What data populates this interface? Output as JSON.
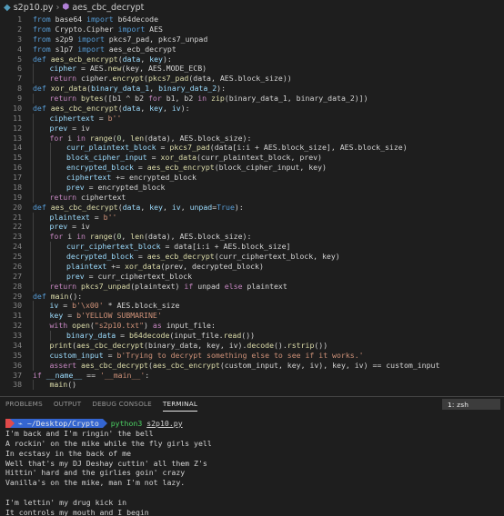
{
  "breadcrumb": {
    "file": "s2p10.py",
    "symbol": "aes_cbc_decrypt"
  },
  "editor": {
    "lines": [
      {
        "n": "1",
        "tokens": [
          [
            "kw",
            "from"
          ],
          [
            "op",
            " base64 "
          ],
          [
            "kw",
            "import"
          ],
          [
            "op",
            " b64decode"
          ]
        ]
      },
      {
        "n": "2",
        "tokens": [
          [
            "kw",
            "from"
          ],
          [
            "op",
            " Crypto.Cipher "
          ],
          [
            "kw",
            "import"
          ],
          [
            "op",
            " AES"
          ]
        ]
      },
      {
        "n": "3",
        "tokens": [
          [
            "kw",
            "from"
          ],
          [
            "op",
            " s2p9 "
          ],
          [
            "kw",
            "import"
          ],
          [
            "op",
            " pkcs7_pad, pkcs7_unpad"
          ]
        ]
      },
      {
        "n": "4",
        "tokens": [
          [
            "kw",
            "from"
          ],
          [
            "op",
            " s1p7 "
          ],
          [
            "kw",
            "import"
          ],
          [
            "op",
            " aes_ecb_decrypt"
          ]
        ]
      },
      {
        "n": "5",
        "tokens": [
          [
            "kw",
            "def"
          ],
          [
            "op",
            " "
          ],
          [
            "fn",
            "aes_ecb_encrypt"
          ],
          [
            "op",
            "("
          ],
          [
            "var",
            "data"
          ],
          [
            "op",
            ", "
          ],
          [
            "var",
            "key"
          ],
          [
            "op",
            "):"
          ]
        ]
      },
      {
        "n": "6",
        "indent": 1,
        "tokens": [
          [
            "var",
            "cipher"
          ],
          [
            "op",
            " = AES."
          ],
          [
            "fn",
            "new"
          ],
          [
            "op",
            "(key, AES.MODE_ECB)"
          ]
        ]
      },
      {
        "n": "7",
        "indent": 1,
        "tokens": [
          [
            "ctl",
            "return"
          ],
          [
            "op",
            " cipher."
          ],
          [
            "fn",
            "encrypt"
          ],
          [
            "op",
            "("
          ],
          [
            "fn",
            "pkcs7_pad"
          ],
          [
            "op",
            "(data, AES.block_size))"
          ]
        ]
      },
      {
        "n": "8",
        "tokens": [
          [
            "kw",
            "def"
          ],
          [
            "op",
            " "
          ],
          [
            "fn",
            "xor_data"
          ],
          [
            "op",
            "("
          ],
          [
            "var",
            "binary_data_1"
          ],
          [
            "op",
            ", "
          ],
          [
            "var",
            "binary_data_2"
          ],
          [
            "op",
            "):"
          ]
        ]
      },
      {
        "n": "9",
        "indent": 1,
        "tokens": [
          [
            "ctl",
            "return"
          ],
          [
            "op",
            " "
          ],
          [
            "fn",
            "bytes"
          ],
          [
            "op",
            "([b1 ^ b2 "
          ],
          [
            "ctl",
            "for"
          ],
          [
            "op",
            " b1, b2 "
          ],
          [
            "ctl",
            "in"
          ],
          [
            "op",
            " "
          ],
          [
            "fn",
            "zip"
          ],
          [
            "op",
            "(binary_data_1, binary_data_2)])"
          ]
        ]
      },
      {
        "n": "10",
        "tokens": [
          [
            "kw",
            "def"
          ],
          [
            "op",
            " "
          ],
          [
            "fn",
            "aes_cbc_encrypt"
          ],
          [
            "op",
            "("
          ],
          [
            "var",
            "data"
          ],
          [
            "op",
            ", "
          ],
          [
            "var",
            "key"
          ],
          [
            "op",
            ", "
          ],
          [
            "var",
            "iv"
          ],
          [
            "op",
            "):"
          ]
        ]
      },
      {
        "n": "11",
        "indent": 1,
        "tokens": [
          [
            "var",
            "ciphertext"
          ],
          [
            "op",
            " = "
          ],
          [
            "str",
            "b''"
          ]
        ]
      },
      {
        "n": "12",
        "indent": 1,
        "tokens": [
          [
            "var",
            "prev"
          ],
          [
            "op",
            " = iv"
          ]
        ]
      },
      {
        "n": "13",
        "indent": 1,
        "tokens": [
          [
            "ctl",
            "for"
          ],
          [
            "op",
            " i "
          ],
          [
            "ctl",
            "in"
          ],
          [
            "op",
            " "
          ],
          [
            "fn",
            "range"
          ],
          [
            "op",
            "("
          ],
          [
            "num",
            "0"
          ],
          [
            "op",
            ", "
          ],
          [
            "fn",
            "len"
          ],
          [
            "op",
            "(data), AES.block_size):"
          ]
        ]
      },
      {
        "n": "14",
        "indent": 2,
        "tokens": [
          [
            "var",
            "curr_plaintext_block"
          ],
          [
            "op",
            " = "
          ],
          [
            "fn",
            "pkcs7_pad"
          ],
          [
            "op",
            "(data[i:i + AES.block_size], AES.block_size)"
          ]
        ]
      },
      {
        "n": "15",
        "indent": 2,
        "tokens": [
          [
            "var",
            "block_cipher_input"
          ],
          [
            "op",
            " = "
          ],
          [
            "fn",
            "xor_data"
          ],
          [
            "op",
            "(curr_plaintext_block, prev)"
          ]
        ]
      },
      {
        "n": "16",
        "indent": 2,
        "tokens": [
          [
            "var",
            "encrypted_block"
          ],
          [
            "op",
            " = "
          ],
          [
            "fn",
            "aes_ecb_encrypt"
          ],
          [
            "op",
            "(block_cipher_input, key)"
          ]
        ]
      },
      {
        "n": "17",
        "indent": 2,
        "tokens": [
          [
            "var",
            "ciphertext"
          ],
          [
            "op",
            " += encrypted_block"
          ]
        ]
      },
      {
        "n": "18",
        "indent": 2,
        "tokens": [
          [
            "var",
            "prev"
          ],
          [
            "op",
            " = encrypted_block"
          ]
        ]
      },
      {
        "n": "19",
        "indent": 1,
        "tokens": [
          [
            "ctl",
            "return"
          ],
          [
            "op",
            " ciphertext"
          ]
        ]
      },
      {
        "n": "20",
        "tokens": [
          [
            "kw",
            "def"
          ],
          [
            "op",
            " "
          ],
          [
            "fn",
            "aes_cbc_decrypt"
          ],
          [
            "op",
            "("
          ],
          [
            "var",
            "data"
          ],
          [
            "op",
            ", "
          ],
          [
            "var",
            "key"
          ],
          [
            "op",
            ", "
          ],
          [
            "var",
            "iv"
          ],
          [
            "op",
            ", "
          ],
          [
            "var",
            "unpad"
          ],
          [
            "op",
            "="
          ],
          [
            "kw",
            "True"
          ],
          [
            "op",
            "):"
          ]
        ]
      },
      {
        "n": "21",
        "indent": 1,
        "tokens": [
          [
            "var",
            "plaintext"
          ],
          [
            "op",
            " = "
          ],
          [
            "str",
            "b''"
          ]
        ]
      },
      {
        "n": "22",
        "indent": 1,
        "tokens": [
          [
            "var",
            "prev"
          ],
          [
            "op",
            " = iv"
          ]
        ]
      },
      {
        "n": "23",
        "indent": 1,
        "tokens": [
          [
            "ctl",
            "for"
          ],
          [
            "op",
            " i "
          ],
          [
            "ctl",
            "in"
          ],
          [
            "op",
            " "
          ],
          [
            "fn",
            "range"
          ],
          [
            "op",
            "("
          ],
          [
            "num",
            "0"
          ],
          [
            "op",
            ", "
          ],
          [
            "fn",
            "len"
          ],
          [
            "op",
            "(data), AES.block_size):"
          ]
        ]
      },
      {
        "n": "24",
        "indent": 2,
        "tokens": [
          [
            "var",
            "curr_ciphertext_block"
          ],
          [
            "op",
            " = data[i:i + AES.block_size]"
          ]
        ]
      },
      {
        "n": "25",
        "indent": 2,
        "tokens": [
          [
            "var",
            "decrypted_block"
          ],
          [
            "op",
            " = "
          ],
          [
            "fn",
            "aes_ecb_decrypt"
          ],
          [
            "op",
            "(curr_ciphertext_block, key)"
          ]
        ]
      },
      {
        "n": "26",
        "indent": 2,
        "tokens": [
          [
            "var",
            "plaintext"
          ],
          [
            "op",
            " += "
          ],
          [
            "fn",
            "xor_data"
          ],
          [
            "op",
            "(prev, decrypted_block)"
          ]
        ]
      },
      {
        "n": "27",
        "indent": 2,
        "tokens": [
          [
            "var",
            "prev"
          ],
          [
            "op",
            " = curr_ciphertext_block"
          ]
        ]
      },
      {
        "n": "28",
        "indent": 1,
        "tokens": [
          [
            "ctl",
            "return"
          ],
          [
            "op",
            " "
          ],
          [
            "fn",
            "pkcs7_unpad"
          ],
          [
            "op",
            "(plaintext) "
          ],
          [
            "ctl",
            "if"
          ],
          [
            "op",
            " unpad "
          ],
          [
            "ctl",
            "else"
          ],
          [
            "op",
            " plaintext"
          ]
        ]
      },
      {
        "n": "29",
        "tokens": [
          [
            "kw",
            "def"
          ],
          [
            "op",
            " "
          ],
          [
            "fn",
            "main"
          ],
          [
            "op",
            "():"
          ]
        ]
      },
      {
        "n": "30",
        "indent": 1,
        "tokens": [
          [
            "var",
            "iv"
          ],
          [
            "op",
            " = "
          ],
          [
            "str",
            "b'\\x00'"
          ],
          [
            "op",
            " * AES.block_size"
          ]
        ]
      },
      {
        "n": "31",
        "indent": 1,
        "tokens": [
          [
            "var",
            "key"
          ],
          [
            "op",
            " = "
          ],
          [
            "str",
            "b'YELLOW SUBMARINE'"
          ]
        ]
      },
      {
        "n": "32",
        "indent": 1,
        "tokens": [
          [
            "ctl",
            "with"
          ],
          [
            "op",
            " "
          ],
          [
            "fn",
            "open"
          ],
          [
            "op",
            "("
          ],
          [
            "str",
            "\"s2p10.txt\""
          ],
          [
            "op",
            ") "
          ],
          [
            "ctl",
            "as"
          ],
          [
            "op",
            " input_file:"
          ]
        ]
      },
      {
        "n": "33",
        "indent": 2,
        "tokens": [
          [
            "var",
            "binary_data"
          ],
          [
            "op",
            " = "
          ],
          [
            "fn",
            "b64decode"
          ],
          [
            "op",
            "(input_file."
          ],
          [
            "fn",
            "read"
          ],
          [
            "op",
            "())"
          ]
        ]
      },
      {
        "n": "34",
        "indent": 1,
        "tokens": [
          [
            "fn",
            "print"
          ],
          [
            "op",
            "("
          ],
          [
            "fn",
            "aes_cbc_decrypt"
          ],
          [
            "op",
            "(binary_data, key, iv)."
          ],
          [
            "fn",
            "decode"
          ],
          [
            "op",
            "()."
          ],
          [
            "fn",
            "rstrip"
          ],
          [
            "op",
            "())"
          ]
        ]
      },
      {
        "n": "35",
        "indent": 1,
        "tokens": [
          [
            "var",
            "custom_input"
          ],
          [
            "op",
            " = "
          ],
          [
            "str",
            "b'Trying to decrypt something else to see if it works.'"
          ]
        ]
      },
      {
        "n": "36",
        "indent": 1,
        "tokens": [
          [
            "ctl",
            "assert"
          ],
          [
            "op",
            " "
          ],
          [
            "fn",
            "aes_cbc_decrypt"
          ],
          [
            "op",
            "("
          ],
          [
            "fn",
            "aes_cbc_encrypt"
          ],
          [
            "op",
            "(custom_input, key, iv), key, iv) == custom_input"
          ]
        ]
      },
      {
        "n": "37",
        "tokens": [
          [
            "ctl",
            "if"
          ],
          [
            "op",
            " "
          ],
          [
            "var",
            "__name__"
          ],
          [
            "op",
            " == "
          ],
          [
            "str",
            "'__main__'"
          ],
          [
            "op",
            ":"
          ]
        ]
      },
      {
        "n": "38",
        "indent": 1,
        "tokens": [
          [
            "fn",
            "main"
          ],
          [
            "op",
            "()"
          ]
        ]
      }
    ]
  },
  "panel": {
    "tabs": [
      "PROBLEMS",
      "OUTPUT",
      "DEBUG CONSOLE",
      "TERMINAL"
    ],
    "active_tab": "TERMINAL",
    "terminal_select": "1: zsh"
  },
  "terminal": {
    "prompt_symbol": "",
    "prompt_dir": "~/Desktop/Crypto",
    "command": "python3",
    "command_arg": "s2p10.py",
    "output": [
      "I'm back and I'm ringin' the bell",
      "A rockin' on the mike while the fly girls yell",
      "In ecstasy in the back of me",
      "Well that's my DJ Deshay cuttin' all them Z's",
      "Hittin' hard and the girlies goin' crazy",
      "Vanilla's on the mike, man I'm not lazy.",
      "",
      "I'm lettin' my drug kick in",
      "It controls my mouth and I begin",
      "To just let it flow, let my concepts go"
    ]
  }
}
